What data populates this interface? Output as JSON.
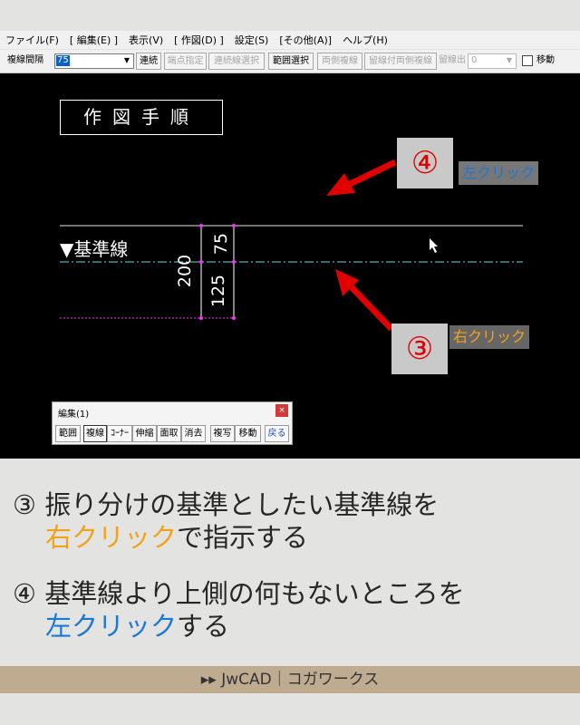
{
  "menu": [
    "ファイル(F)",
    "[ 編集(E) ]",
    "表示(V)",
    "[ 作図(D) ]",
    "設定(S)",
    "[その他(A)]",
    "ヘルプ(H)"
  ],
  "toolbar": {
    "multiline_label": "複線間隔",
    "multiline_value": "75",
    "renzoku": "連続",
    "endpoint": "端点指定",
    "continuous_select": "連続線選択",
    "range_select": "範囲選択",
    "both_multiline": "両側複線",
    "stay_both": "留線付両側複線",
    "stay_out": "留線出",
    "stay_value": "0",
    "move_label": "移動"
  },
  "canvas": {
    "title": "作図手順",
    "base_label": "▼基準線",
    "dim_75": "75",
    "dim_125": "125",
    "dim_200": "200",
    "badge_4": "④",
    "tag_left": "左クリック",
    "badge_3": "③",
    "tag_right": "右クリック"
  },
  "palette": {
    "title": "編集(1)",
    "close": "×",
    "buttons": [
      "範囲",
      "複線",
      "ｺｰﾅｰ",
      "伸縮",
      "面取",
      "消去",
      "複写",
      "移動",
      "戻る"
    ]
  },
  "caption": {
    "step3_line1": "③ 振り分けの基準としたい基準線を",
    "step3_highlight": "右クリック",
    "step3_rest": "で指示する",
    "step4_line1": "④ 基準線より上側の何もないところを",
    "step4_highlight": "左クリック",
    "step4_rest": "する"
  },
  "footer": "▸▸ JwCAD｜コガワークス",
  "colors": {
    "red": "#e00000",
    "blue": "#1a78d6",
    "orange": "#f2a31c",
    "footer": "#bfac90"
  }
}
